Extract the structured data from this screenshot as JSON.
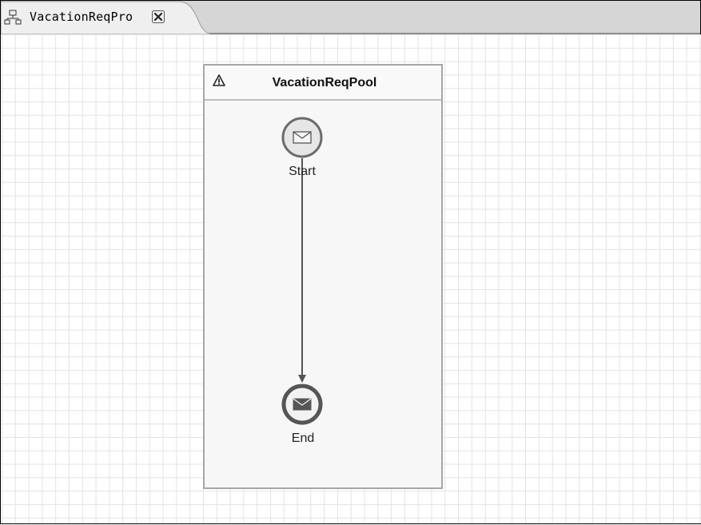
{
  "editor": {
    "tab_title": "VacationReqPro",
    "tab_icon": "process-diagram-icon",
    "close_icon": "close-icon"
  },
  "diagram": {
    "pool": {
      "title": "VacationReqPool",
      "icon": "warning-icon"
    },
    "start_event": {
      "label": "Start",
      "icon": "envelope-icon"
    },
    "end_event": {
      "label": "End",
      "icon": "envelope-filled-icon"
    },
    "sequence_flow": {
      "from": "Start",
      "to": "End"
    }
  },
  "colors": {
    "tabbar_bg": "#d6d6d6",
    "grid_line": "#e3e3e3",
    "pool_border": "#a6a6a6",
    "event_stroke": "#6b6b6b",
    "end_event_stroke": "#555555"
  }
}
